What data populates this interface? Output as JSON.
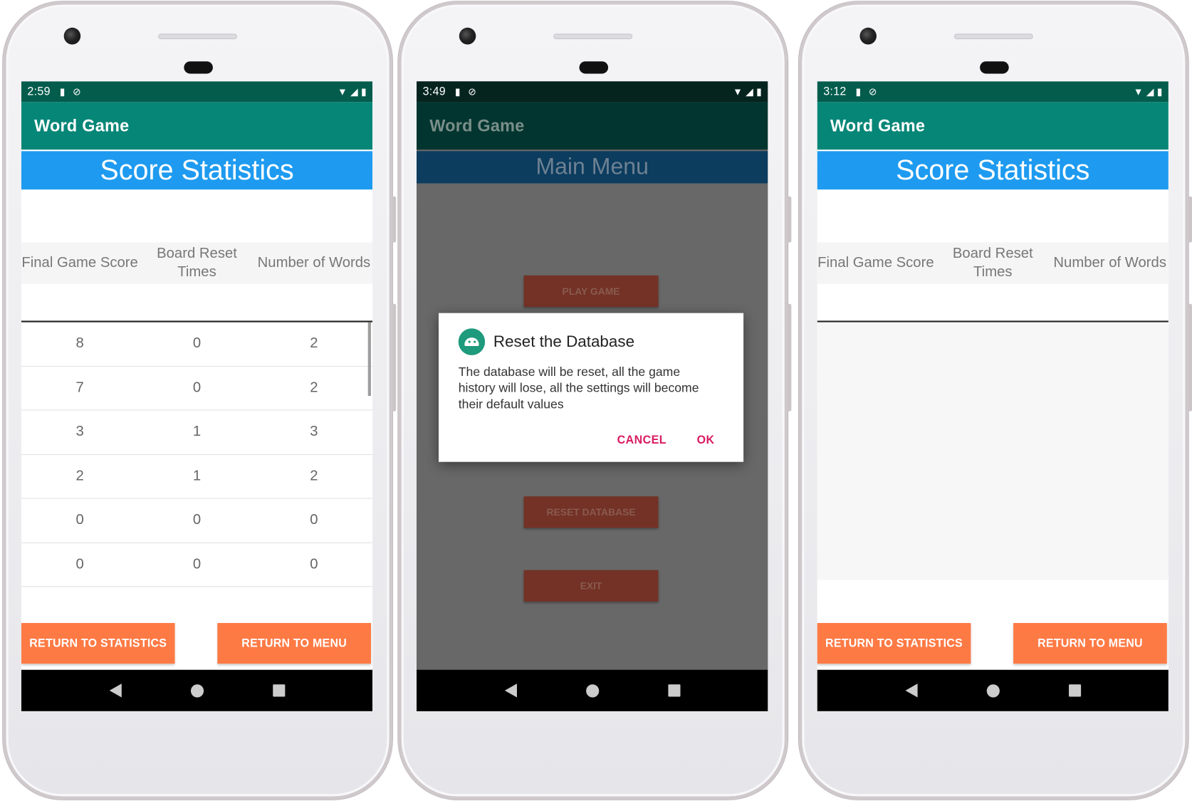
{
  "colors": {
    "status_bar": "#045c4c",
    "app_bar": "#068677",
    "blue_header": "#1e9bf0",
    "orange_button": "#fe7a45",
    "dialog_action": "#d81b60"
  },
  "phone1": {
    "status_time": "2:59",
    "app_title": "Word Game",
    "screen_title": "Score Statistics",
    "columns": [
      "Final Game Score",
      "Board Reset Times",
      "Number of Words"
    ],
    "rows": [
      [
        "8",
        "0",
        "2"
      ],
      [
        "7",
        "0",
        "2"
      ],
      [
        "3",
        "1",
        "3"
      ],
      [
        "2",
        "1",
        "2"
      ],
      [
        "0",
        "0",
        "0"
      ],
      [
        "0",
        "0",
        "0"
      ]
    ],
    "btn_return_stats": "RETURN TO STATISTICS",
    "btn_return_menu": "RETURN TO MENU"
  },
  "phone2": {
    "status_time": "3:49",
    "app_title": "Word Game",
    "screen_title": "Main Menu",
    "menu_buttons": [
      "PLAY GAME",
      "RESET DATABASE",
      "EXIT"
    ],
    "dialog": {
      "title": "Reset the Database",
      "message": "The database will be reset, all the game history will lose, all the settings will become their default values",
      "cancel": "CANCEL",
      "ok": "OK"
    }
  },
  "phone3": {
    "status_time": "3:12",
    "app_title": "Word Game",
    "screen_title": "Score Statistics",
    "columns": [
      "Final Game Score",
      "Board Reset Times",
      "Number of Words"
    ],
    "btn_return_stats": "RETURN TO STATISTICS",
    "btn_return_menu": "RETURN TO MENU"
  },
  "icons": {
    "status_left": [
      "sd-card-icon",
      "sync-disabled-icon"
    ],
    "status_right": [
      "wifi-icon",
      "signal-icon",
      "battery-icon"
    ],
    "nav": [
      "back-icon",
      "home-icon",
      "recents-icon"
    ]
  }
}
